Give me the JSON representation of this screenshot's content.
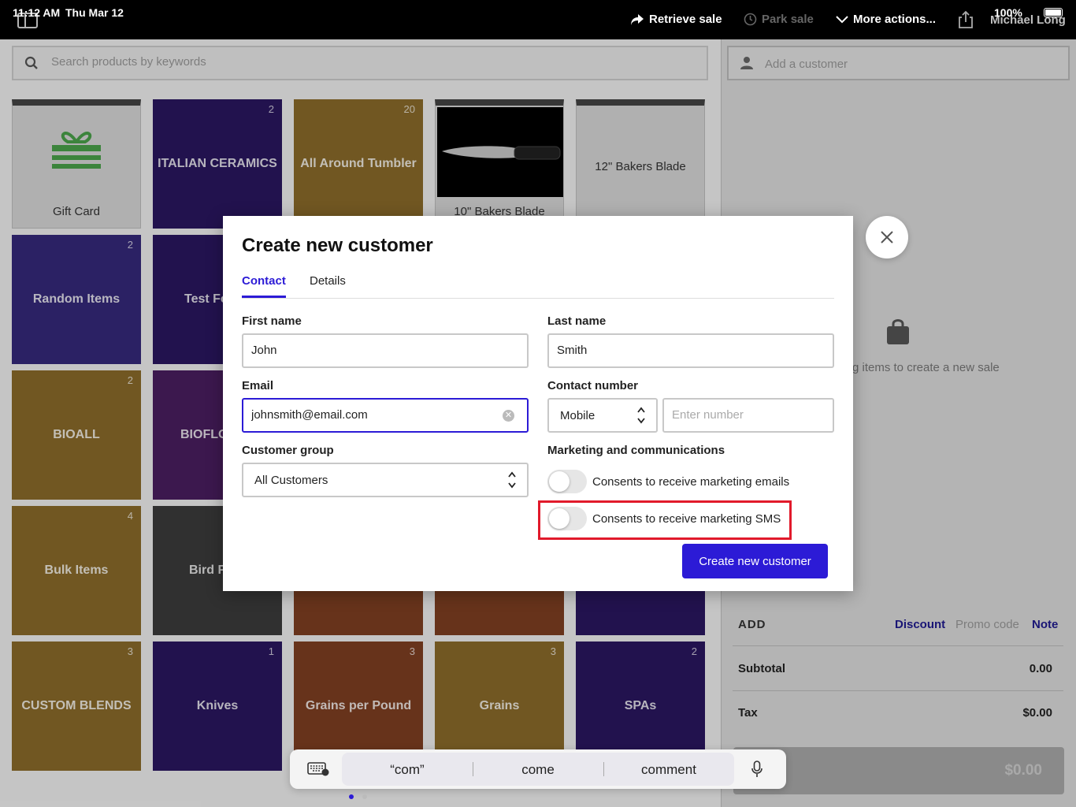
{
  "status_bar": {
    "time": "11:12 AM",
    "date": "Thu Mar 12",
    "battery": "100%"
  },
  "toolbar": {
    "retrieve_sale": "Retrieve sale",
    "park_sale": "Park sale",
    "more_actions": "More actions...",
    "user_name": "Michael Long"
  },
  "search": {
    "placeholder": "Search products by keywords"
  },
  "tiles": [
    {
      "label": "Gift Card",
      "count": ""
    },
    {
      "label": "ITALIAN CERAMICS",
      "count": "2"
    },
    {
      "label": "All Around Tumbler",
      "count": "20"
    },
    {
      "label": "10\" Bakers Blade",
      "count": ""
    },
    {
      "label": "12\" Bakers Blade",
      "count": ""
    },
    {
      "label": "Random Items",
      "count": "2"
    },
    {
      "label": "Test Fo",
      "count": ""
    },
    {
      "label": "BIOALL",
      "count": "2"
    },
    {
      "label": "BIOFLO",
      "count": ""
    },
    {
      "label": "Bulk Items",
      "count": "4"
    },
    {
      "label": "Bird F",
      "count": ""
    },
    {
      "label": "CUSTOM BLENDS",
      "count": "3"
    },
    {
      "label": "Knives",
      "count": "1"
    },
    {
      "label": "Grains per Pound",
      "count": "3"
    },
    {
      "label": "Grains",
      "count": "3"
    },
    {
      "label": "SPAs",
      "count": "2"
    }
  ],
  "cart": {
    "add_customer_placeholder": "Add a customer",
    "empty_hint": "g items to create a new sale",
    "add_label": "ADD",
    "discount": "Discount",
    "promo_code": "Promo code",
    "note": "Note",
    "subtotal_label": "Subtotal",
    "subtotal_value": "0.00",
    "tax_label": "Tax",
    "tax_value": "$0.00",
    "pay_amount": "$0.00"
  },
  "modal": {
    "title": "Create new customer",
    "tabs": [
      "Contact",
      "Details"
    ],
    "first_name_label": "First name",
    "first_name_value": "John",
    "last_name_label": "Last name",
    "last_name_value": "Smith",
    "email_label": "Email",
    "email_value": "johnsmith@email.com",
    "contact_number_label": "Contact number",
    "phone_type": "Mobile",
    "phone_placeholder": "Enter number",
    "customer_group_label": "Customer group",
    "customer_group_value": "All Customers",
    "marketing_label": "Marketing and communications",
    "consent_emails": "Consents to receive marketing emails",
    "consent_emails_on": false,
    "consent_sms": "Consents to receive marketing SMS",
    "consent_sms_on": false,
    "create_button": "Create new customer"
  },
  "keyboard": {
    "suggestions": [
      "“com”",
      "come",
      "comment"
    ]
  },
  "colors": {
    "accent": "#2c1bd6",
    "highlight": "#e11a2b"
  }
}
